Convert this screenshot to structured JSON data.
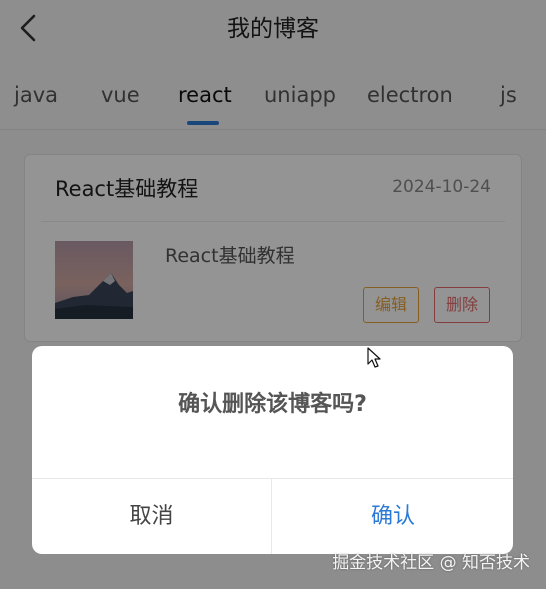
{
  "header": {
    "title": "我的博客",
    "back_icon": "chevron-left-icon"
  },
  "tabs": {
    "items": [
      {
        "label": "java"
      },
      {
        "label": "vue"
      },
      {
        "label": "react"
      },
      {
        "label": "uniapp"
      },
      {
        "label": "electron"
      },
      {
        "label": "js"
      }
    ],
    "active": "react",
    "accent_color": "#2b7bd6"
  },
  "card": {
    "title": "React基础教程",
    "date": "2024-10-24",
    "summary": "React基础教程",
    "edit_label": "编辑",
    "delete_label": "删除",
    "edit_color": "#e6a23c",
    "delete_color": "#e56c6c"
  },
  "dialog": {
    "message": "确认删除该博客吗?",
    "cancel_label": "取消",
    "confirm_label": "确认",
    "confirm_color": "#2b7bd6"
  },
  "watermark": "掘金技术社区 @ 知否技术"
}
